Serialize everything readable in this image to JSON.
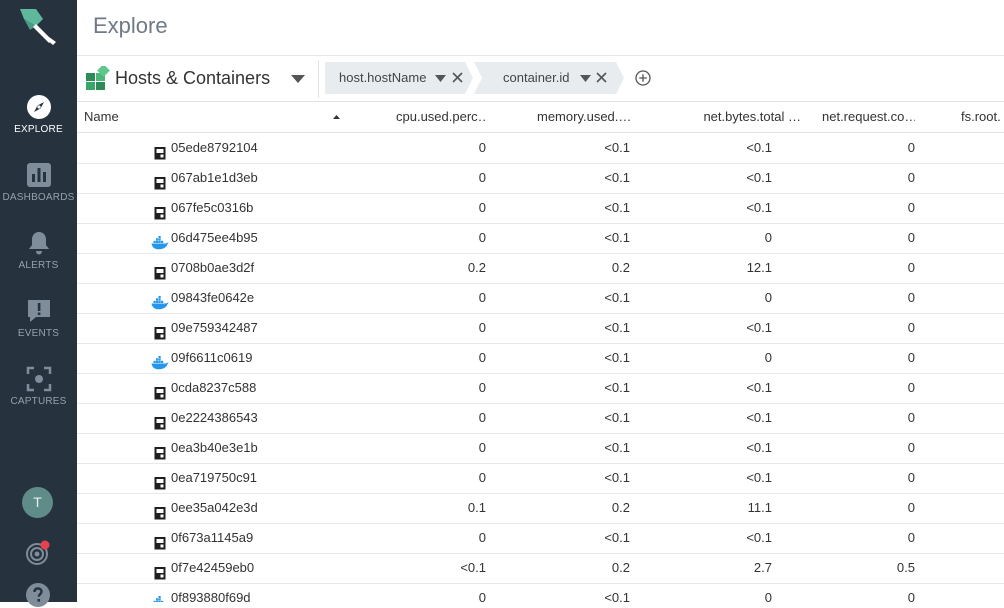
{
  "sidebar": {
    "items": [
      {
        "label": "EXPLORE",
        "icon": "compass-icon",
        "active": true
      },
      {
        "label": "DASHBOARDS",
        "icon": "bar-chart-icon",
        "active": false
      },
      {
        "label": "ALERTS",
        "icon": "bell-icon",
        "active": false
      },
      {
        "label": "EVENTS",
        "icon": "exclamation-bubble-icon",
        "active": false
      },
      {
        "label": "CAPTURES",
        "icon": "capture-icon",
        "active": false
      }
    ],
    "avatar_initial": "T"
  },
  "header": {
    "title": "Explore"
  },
  "toolbar": {
    "scope_label": "Hosts & Containers",
    "breadcrumbs": [
      {
        "label": "host.hostName"
      },
      {
        "label": "container.id"
      }
    ]
  },
  "table": {
    "columns": [
      {
        "label": "Name"
      },
      {
        "label": "cpu.used.perc…"
      },
      {
        "label": "memory.used.…"
      },
      {
        "label": "net.bytes.total …"
      },
      {
        "label": "net.request.co…"
      },
      {
        "label": "fs.root."
      }
    ],
    "rows": [
      {
        "icon": "container",
        "name": "05ede8792104",
        "cpu": "0",
        "mem": "<0.1",
        "net": "<0.1",
        "req": "0"
      },
      {
        "icon": "container",
        "name": "067ab1e1d3eb",
        "cpu": "0",
        "mem": "<0.1",
        "net": "<0.1",
        "req": "0"
      },
      {
        "icon": "container",
        "name": "067fe5c0316b",
        "cpu": "0",
        "mem": "<0.1",
        "net": "<0.1",
        "req": "0"
      },
      {
        "icon": "docker",
        "name": "06d475ee4b95",
        "cpu": "0",
        "mem": "<0.1",
        "net": "0",
        "req": "0"
      },
      {
        "icon": "container",
        "name": "0708b0ae3d2f",
        "cpu": "0.2",
        "mem": "0.2",
        "net": "12.1",
        "req": "0"
      },
      {
        "icon": "docker",
        "name": "09843fe0642e",
        "cpu": "0",
        "mem": "<0.1",
        "net": "0",
        "req": "0"
      },
      {
        "icon": "container",
        "name": "09e759342487",
        "cpu": "0",
        "mem": "<0.1",
        "net": "<0.1",
        "req": "0"
      },
      {
        "icon": "docker",
        "name": "09f6611c0619",
        "cpu": "0",
        "mem": "<0.1",
        "net": "0",
        "req": "0"
      },
      {
        "icon": "container",
        "name": "0cda8237c588",
        "cpu": "0",
        "mem": "<0.1",
        "net": "<0.1",
        "req": "0"
      },
      {
        "icon": "container",
        "name": "0e2224386543",
        "cpu": "0",
        "mem": "<0.1",
        "net": "<0.1",
        "req": "0"
      },
      {
        "icon": "container",
        "name": "0ea3b40e3e1b",
        "cpu": "0",
        "mem": "<0.1",
        "net": "<0.1",
        "req": "0"
      },
      {
        "icon": "container",
        "name": "0ea719750c91",
        "cpu": "0",
        "mem": "<0.1",
        "net": "<0.1",
        "req": "0"
      },
      {
        "icon": "container",
        "name": "0ee35a042e3d",
        "cpu": "0.1",
        "mem": "0.2",
        "net": "11.1",
        "req": "0"
      },
      {
        "icon": "container",
        "name": "0f673a1145a9",
        "cpu": "0",
        "mem": "<0.1",
        "net": "<0.1",
        "req": "0"
      },
      {
        "icon": "container",
        "name": "0f7e42459eb0",
        "cpu": "<0.1",
        "mem": "0.2",
        "net": "2.7",
        "req": "0.5"
      },
      {
        "icon": "docker",
        "name": "0f893880f69d",
        "cpu": "0",
        "mem": "<0.1",
        "net": "0",
        "req": "0"
      }
    ]
  },
  "colors": {
    "sidebar_bg": "#26323e",
    "accent": "#5fb89c",
    "notification_dot": "#e8414f",
    "docker_blue": "#2496ed"
  }
}
